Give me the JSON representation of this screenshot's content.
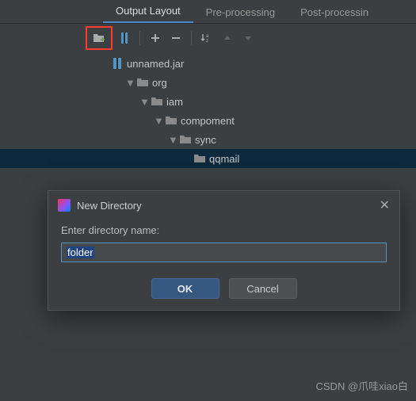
{
  "tabs": {
    "output_layout": "Output Layout",
    "pre_processing": "Pre-processing",
    "post_processing": "Post-processin"
  },
  "tree": {
    "jar": "unnamed.jar",
    "n1": "org",
    "n2": "iam",
    "n3": "compoment",
    "n4": "sync",
    "n5": "qqmail"
  },
  "dialog": {
    "title": "New Directory",
    "prompt": "Enter directory name:",
    "value": "folder",
    "ok": "OK",
    "cancel": "Cancel"
  },
  "watermark": "CSDN @爪哇xiao白"
}
